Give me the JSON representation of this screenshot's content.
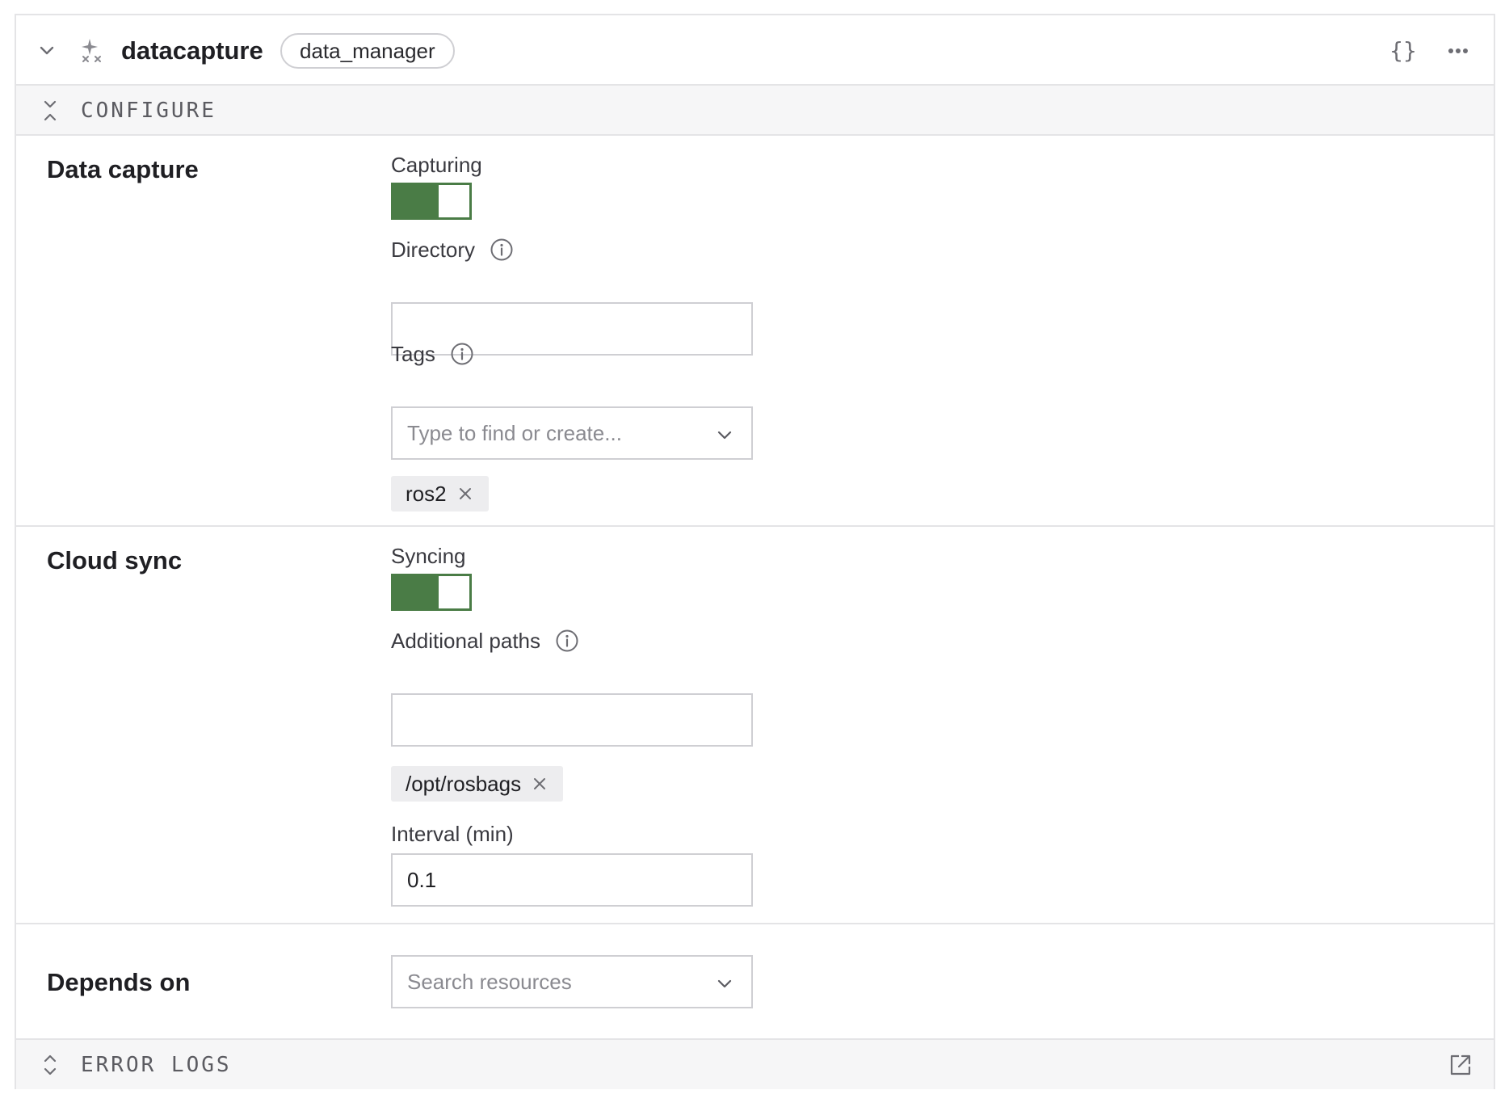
{
  "header": {
    "name": "datacapture",
    "model": "data_manager",
    "json_label": "{}"
  },
  "configure_bar": {
    "label": "CONFIGURE"
  },
  "data_capture": {
    "title": "Data capture",
    "capturing_label": "Capturing",
    "capturing_on": true,
    "directory_label": "Directory",
    "directory_value": "",
    "tags_label": "Tags",
    "tags_placeholder": "Type to find or create...",
    "tags": [
      "ros2"
    ]
  },
  "cloud_sync": {
    "title": "Cloud sync",
    "syncing_label": "Syncing",
    "syncing_on": true,
    "additional_paths_label": "Additional paths",
    "additional_paths_value": "",
    "paths": [
      "/opt/rosbags"
    ],
    "interval_label": "Interval (min)",
    "interval_value": "0.1"
  },
  "depends_on": {
    "title": "Depends on",
    "placeholder": "Search resources"
  },
  "error_logs_bar": {
    "label": "ERROR LOGS"
  },
  "colors": {
    "toggle_on": "#4a7c46",
    "border": "#e4e4e6",
    "bar_bg": "#f6f6f7"
  }
}
